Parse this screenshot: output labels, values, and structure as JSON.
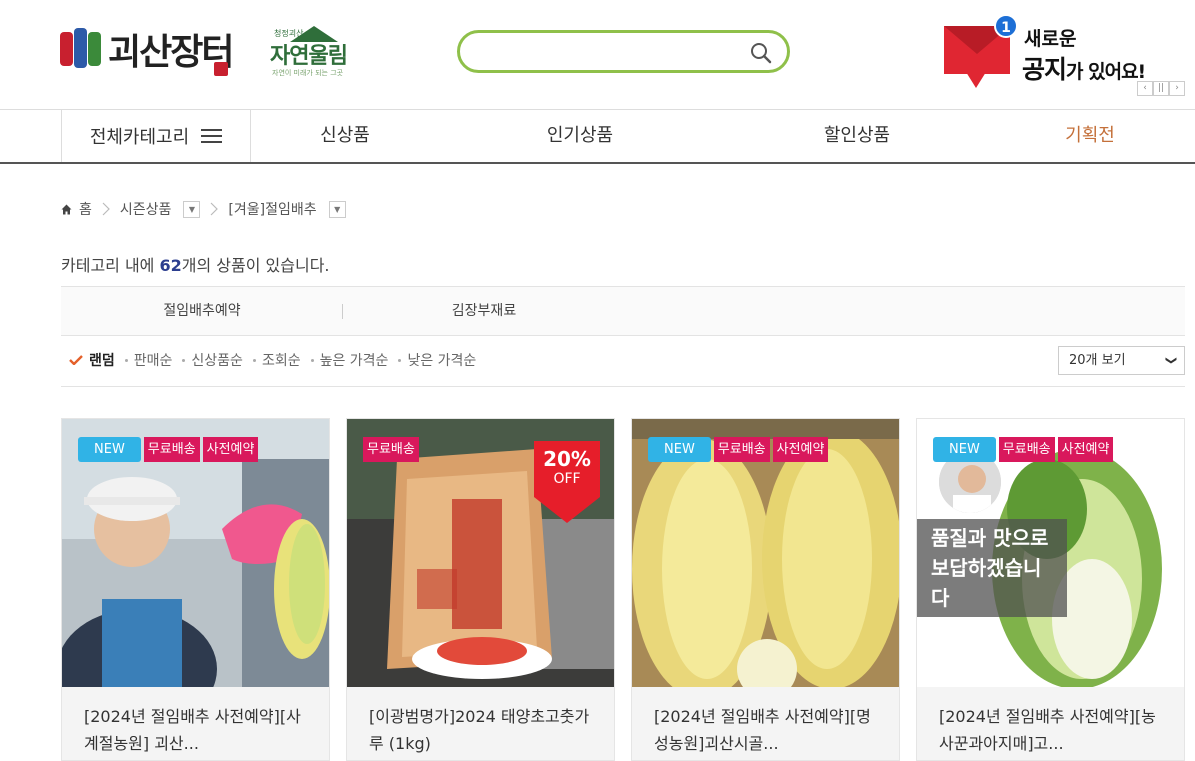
{
  "header": {
    "logo_main": "괴산장터",
    "logo_sub_small": "청정괴산",
    "logo_sub_big": "자연울림",
    "logo_sub_tag": "자연이 미래가 되는 그곳",
    "search_placeholder": "",
    "notice": {
      "count": "1",
      "line1": "새로운",
      "line2_big": "공지",
      "line2_small": "가 있어요!",
      "prev": "‹",
      "pause": "||",
      "next": "›"
    }
  },
  "nav": {
    "all_categories": "전체카테고리",
    "items": [
      "신상품",
      "인기상품",
      "할인상품",
      "기획전"
    ]
  },
  "breadcrumb": {
    "home": "홈",
    "level1": "시즌상품",
    "level2": "[겨울]절임배추"
  },
  "count_line": {
    "prefix": "카테고리 내에 ",
    "count": "62",
    "suffix": "개의 상품이 있습니다."
  },
  "subcategories": [
    "절임배추예약",
    "김장부재료"
  ],
  "sort": {
    "options": [
      "랜덤",
      "판매순",
      "신상품순",
      "조회순",
      "높은 가격순",
      "낮은 가격순"
    ],
    "active_index": 0,
    "view_label": "20개 보기",
    "view_arrow": "❯"
  },
  "products": [
    {
      "badges": [
        "NEW",
        "무료배송",
        "사전예약"
      ],
      "name": "[2024년 절임배추 사전예약][사계절농원] 괴산..."
    },
    {
      "badges": [
        "무료배송"
      ],
      "discount_pct": "20%",
      "discount_off": "OFF",
      "name": "[이광범명가]2024 태양초고춧가루 (1kg)"
    },
    {
      "badges": [
        "NEW",
        "무료배송",
        "사전예약"
      ],
      "name": "[2024년 절임배추 사전예약][명성농원]괴산시골..."
    },
    {
      "badges": [
        "NEW",
        "무료배송",
        "사전예약"
      ],
      "overlay": "품질과 맛으로 보답하겠습니다",
      "name": "[2024년 절임배추 사전예약][농사꾼과아지매]고..."
    }
  ],
  "colors": {
    "accent_green": "#8fc04a",
    "badge_new": "#30b3e6",
    "badge_red": "#d9185c",
    "special_nav": "#c4703a",
    "count_blue": "#2c3e8f"
  }
}
